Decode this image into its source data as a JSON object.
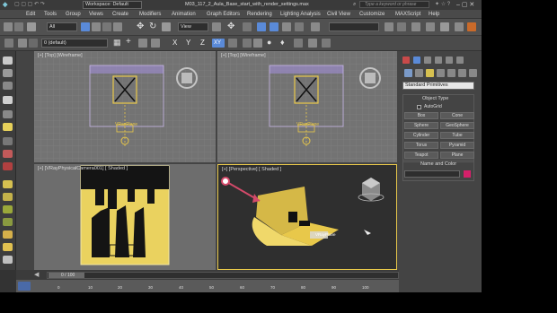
{
  "window": {
    "workspace": "Workspace: Default",
    "title": "M03_117_2_Aula_Base_start_with_render_settings.max",
    "search_placeholder": "Type a keyword or phrase"
  },
  "menu": [
    "Edit",
    "Tools",
    "Group",
    "Views",
    "Create",
    "Modifiers",
    "Animation",
    "Graph Editors",
    "Rendering",
    "Lighting Analysis",
    "Civil View",
    "Customize",
    "MAXScript",
    "Help"
  ],
  "toolbar": {
    "selection_filter": "All",
    "ref_coord": "View",
    "layer": "0 (default)",
    "axes": [
      "X",
      "Y",
      "Z",
      "XY"
    ]
  },
  "viewports": {
    "top_left_label": "[+] [Top] [Wireframe]",
    "top_right_label": "[+] [Top] [Wireframe]",
    "bottom_left_label": "[+] [VRayPhysicalCamera001] [ Shaded ]",
    "bottom_right_label": "[+] [Perspective] [ Shaded ]",
    "object_label": "VRayPlane"
  },
  "command_panel": {
    "category": "Standard Primitives",
    "rollout_object_type": "Object Type",
    "autogrid": "AutoGrid",
    "buttons": [
      "Box",
      "Cone",
      "Sphere",
      "GeoSphere",
      "Cylinder",
      "Tube",
      "Torus",
      "Pyramid",
      "Teapot",
      "Plane"
    ],
    "rollout_name_color": "Name and Color",
    "name_color": "#d4206a"
  },
  "timeline": {
    "frame": "0 / 100",
    "ticks": [
      "0",
      "10",
      "20",
      "30",
      "40",
      "50",
      "60",
      "70",
      "80",
      "90",
      "100"
    ]
  },
  "colors": {
    "accent": "#e8c84a",
    "active_tool": "#5a8ad8"
  }
}
